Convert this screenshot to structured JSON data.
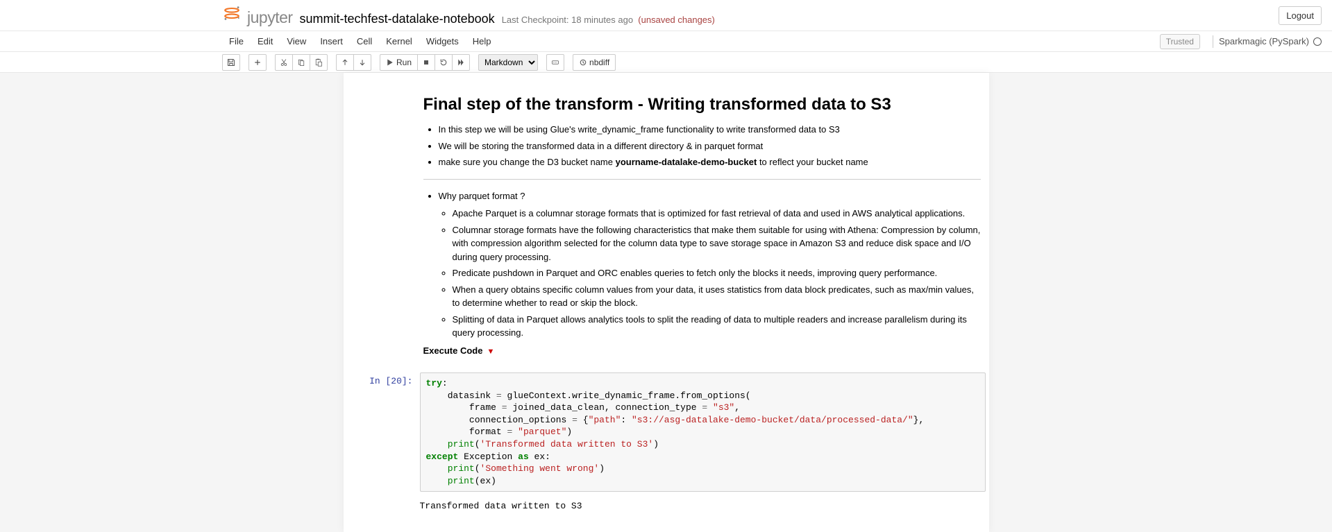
{
  "header": {
    "logo_text": "jupyter",
    "notebook_name": "summit-techfest-datalake-notebook",
    "checkpoint_prefix": "Last Checkpoint:",
    "checkpoint_time": "18 minutes ago",
    "unsaved": "(unsaved changes)",
    "logout": "Logout"
  },
  "menu": {
    "file": "File",
    "edit": "Edit",
    "view": "View",
    "insert": "Insert",
    "cell": "Cell",
    "kernel": "Kernel",
    "widgets": "Widgets",
    "help": "Help",
    "trusted": "Trusted",
    "kernel_name": "Sparkmagic (PySpark)"
  },
  "toolbar": {
    "run": "Run",
    "cell_type": "Markdown",
    "nbdiff": "nbdiff"
  },
  "markdown_section": {
    "heading": "Final step of the transform - Writing transformed data to S3",
    "bullets_a": {
      "b1": "In this step we will be using Glue's write_dynamic_frame functionality to write transformed data to S3",
      "b2": "We will be storing the transformed data in a different directory & in parquet format",
      "b3_pre": "make sure you change the D3 bucket name ",
      "b3_bold": "yourname-datalake-demo-bucket",
      "b3_post": " to reflect your bucket name"
    },
    "why": "Why parquet format ?",
    "parquet_points": {
      "p1": "Apache Parquet is a columnar storage formats that is optimized for fast retrieval of data and used in AWS analytical applications.",
      "p2": "Columnar storage formats have the following characteristics that make them suitable for using with Athena: Compression by column, with compression algorithm selected for the column data type to save storage space in Amazon S3 and reduce disk space and I/O during query processing.",
      "p3": "Predicate pushdown in Parquet and ORC enables queries to fetch only the blocks it needs, improving query performance.",
      "p4": "When a query obtains specific column values from your data, it uses statistics from data block predicates, such as max/min values, to determine whether to read or skip the block.",
      "p5": "Splitting of data in Parquet allows analytics tools to split the reading of data to multiple readers and increase parallelism during its query processing."
    },
    "exec_label": "Execute Code",
    "tri": "▼"
  },
  "code_cell": {
    "prompt": "In [20]:",
    "output": "Transformed data written to S3",
    "code": {
      "l1_try": "try",
      "l2_a": "    datasink ",
      "l2_b": " glueContext.write_dynamic_frame.from_options(",
      "l3_a": "        frame ",
      "l3_b": " joined_data_clean, connection_type ",
      "l3_s": "\"s3\"",
      "l4_a": "        connection_options ",
      "l4_b": " {",
      "l4_k": "\"path\"",
      "l4_c": ": ",
      "l4_v": "\"s3://asg-datalake-demo-bucket/data/processed-data/\"",
      "l4_d": "},",
      "l5_a": "        format ",
      "l5_s": "\"parquet\"",
      "l6_print": "print",
      "l6_s": "'Transformed data written to S3'",
      "l7_except": "except",
      "l7_b": " Exception ",
      "l7_as": "as",
      "l7_c": " ex:",
      "l8_s": "'Something went wrong'",
      "l9_ex": "ex"
    }
  }
}
